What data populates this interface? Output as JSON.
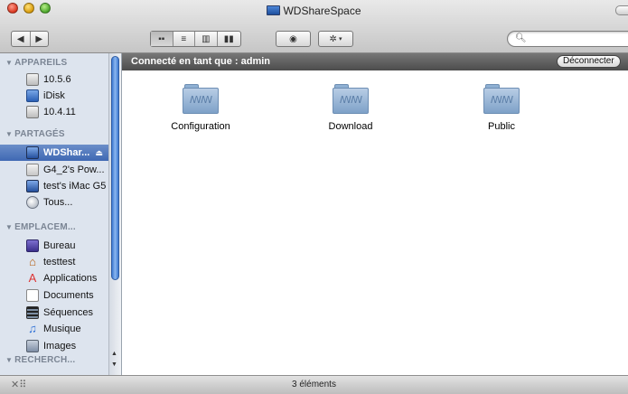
{
  "window": {
    "title": "WDShareSpace"
  },
  "toolbar": {
    "back_icon": "back-arrow-icon",
    "forward_icon": "forward-arrow-icon",
    "view_modes": [
      "icon-view-icon",
      "list-view-icon",
      "column-view-icon",
      "coverflow-view-icon"
    ],
    "selected_view": "icon-view-icon",
    "quicklook_icon": "eye-icon",
    "action_icon": "gear-icon",
    "search_placeholder": ""
  },
  "sidebar": {
    "sections": [
      {
        "title": "APPAREILS",
        "items": [
          {
            "label": "10.5.6",
            "icon": "disk-icon"
          },
          {
            "label": "iDisk",
            "icon": "idisk-icon"
          },
          {
            "label": "10.4.11",
            "icon": "disk-icon"
          }
        ]
      },
      {
        "title": "PARTAGÉS",
        "items": [
          {
            "label": "WDShar...",
            "icon": "monitor-icon",
            "selected": true
          },
          {
            "label": "G4_2's Pow...",
            "icon": "generic-computer-icon"
          },
          {
            "label": "test's iMac G5",
            "icon": "monitor-icon"
          },
          {
            "label": "Tous...",
            "icon": "network-globe-icon"
          }
        ]
      },
      {
        "title": "EMPLACEM...",
        "items": [
          {
            "label": "Bureau",
            "icon": "desktop-icon"
          },
          {
            "label": "testtest",
            "icon": "home-icon"
          },
          {
            "label": "Applications",
            "icon": "applications-icon"
          },
          {
            "label": "Documents",
            "icon": "document-icon"
          },
          {
            "label": "Séquences",
            "icon": "film-icon"
          },
          {
            "label": "Musique",
            "icon": "music-icon"
          },
          {
            "label": "Images",
            "icon": "pictures-icon"
          }
        ]
      },
      {
        "title": "RECHERCH...",
        "items": []
      }
    ]
  },
  "connection": {
    "status": "Connecté en tant que : admin",
    "disconnect_label": "Déconnecter"
  },
  "files": [
    {
      "name": "Configuration",
      "icon": "shared-folder-icon"
    },
    {
      "name": "Download",
      "icon": "shared-folder-icon"
    },
    {
      "name": "Public",
      "icon": "shared-folder-icon"
    }
  ],
  "status": {
    "count": "3 éléments"
  }
}
